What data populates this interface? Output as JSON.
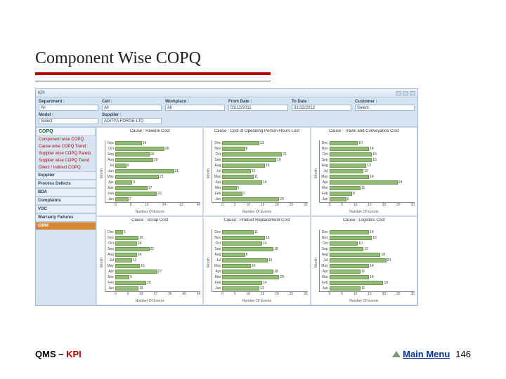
{
  "slide": {
    "title": "Component Wise COPQ",
    "footer_left_prefix": "QMS – ",
    "footer_left_kpi": "KPI",
    "main_menu_label": "Main Menu",
    "page_number": "146"
  },
  "app": {
    "window_title": "KPI",
    "filters": {
      "department": {
        "label": "Department :",
        "value": "All"
      },
      "cell": {
        "label": "Cell :",
        "value": "All"
      },
      "workplace": {
        "label": "Workplace :",
        "value": "All"
      },
      "from_date": {
        "label": "From Date :",
        "value": "01/12/2011"
      },
      "to_date": {
        "label": "To Date :",
        "value": "31/12/2012"
      },
      "customer": {
        "label": "Customer :",
        "value": "Select"
      },
      "model": {
        "label": "Model :",
        "value": "Select"
      },
      "supplier": {
        "label": "Supplier :",
        "value": "ADITYA FORGE LTD"
      }
    },
    "sidebar": {
      "head": "COPQ",
      "links": [
        "Component wise COPQ",
        "Cause wise COPQ Trend",
        "Supplier wise COPQ Pareto",
        "Supplier wise COPQ Trend",
        "Direct / Indirect COPQ"
      ],
      "sections": [
        "Supplier",
        "Process Defects",
        "BDA",
        "Complaints",
        "VOC",
        "Warranty Failures",
        "CWM"
      ],
      "active_section": "CWM"
    }
  },
  "chart_data": [
    {
      "type": "bar",
      "title": "Cause : Rework Cost",
      "ylabel": "Month",
      "xlabel": "Number Of Events",
      "ylim": [
        0,
        45
      ],
      "categories": [
        "Nov",
        "Oct",
        "Sep",
        "Aug",
        "Jul",
        "Jun",
        "May",
        "Apr",
        "Mar",
        "Feb",
        "Jan"
      ],
      "values": [
        14,
        26,
        18,
        20,
        6,
        31,
        23,
        9,
        17,
        22,
        7
      ]
    },
    {
      "type": "bar",
      "title": "Cause : Cost of Operating Person-Hours Lost",
      "ylabel": "Month",
      "xlabel": "Number Of Events",
      "ylim": [
        0,
        30
      ],
      "categories": [
        "Dec",
        "Nov",
        "Oct",
        "Sep",
        "Aug",
        "Jul",
        "May",
        "Apr",
        "Mar",
        "Feb",
        "Jan"
      ],
      "values": [
        13,
        8,
        21,
        19,
        15,
        10,
        11,
        14,
        5,
        7,
        20
      ]
    },
    {
      "type": "bar",
      "title": "Cause : Travel and Conveyance Cost",
      "ylabel": "Month",
      "xlabel": "Number Of Events",
      "ylim": [
        0,
        30
      ],
      "categories": [
        "Dec",
        "Nov",
        "Oct",
        "Sep",
        "Aug",
        "Jul",
        "May",
        "Apr",
        "Mar",
        "Feb",
        "Jan"
      ],
      "values": [
        10,
        14,
        15,
        15,
        13,
        12,
        14,
        24,
        11,
        8,
        6
      ]
    },
    {
      "type": "bar",
      "title": "Cause : Scrap Cost",
      "ylabel": "Month",
      "xlabel": "Number Of Events",
      "ylim": [
        0,
        55
      ],
      "categories": [
        "Dec",
        "Nov",
        "Oct",
        "Sep",
        "Aug",
        "Jul",
        "May",
        "Apr",
        "Mar",
        "Feb",
        "Jan"
      ],
      "values": [
        5,
        15,
        14,
        22,
        14,
        11,
        16,
        27,
        9,
        20,
        15
      ]
    },
    {
      "type": "bar",
      "title": "Cause : Product Replacement Cost",
      "ylabel": "Month",
      "xlabel": "Number Of Events",
      "ylim": [
        0,
        30
      ],
      "categories": [
        "Dec",
        "Nov",
        "Oct",
        "Sep",
        "Aug",
        "Jul",
        "May",
        "Apr",
        "Mar",
        "Feb",
        "Jan"
      ],
      "values": [
        11,
        15,
        14,
        18,
        8,
        16,
        10,
        18,
        20,
        14,
        13
      ]
    },
    {
      "type": "bar",
      "title": "Cause : Logistics Cost",
      "ylabel": "Month",
      "xlabel": "Number Of Events",
      "ylim": [
        0,
        30
      ],
      "categories": [
        "Dec",
        "Nov",
        "Oct",
        "Sep",
        "Aug",
        "Jul",
        "May",
        "Apr",
        "Mar",
        "Feb",
        "Jan"
      ],
      "values": [
        14,
        15,
        10,
        12,
        18,
        20,
        14,
        11,
        14,
        19,
        11
      ]
    }
  ]
}
